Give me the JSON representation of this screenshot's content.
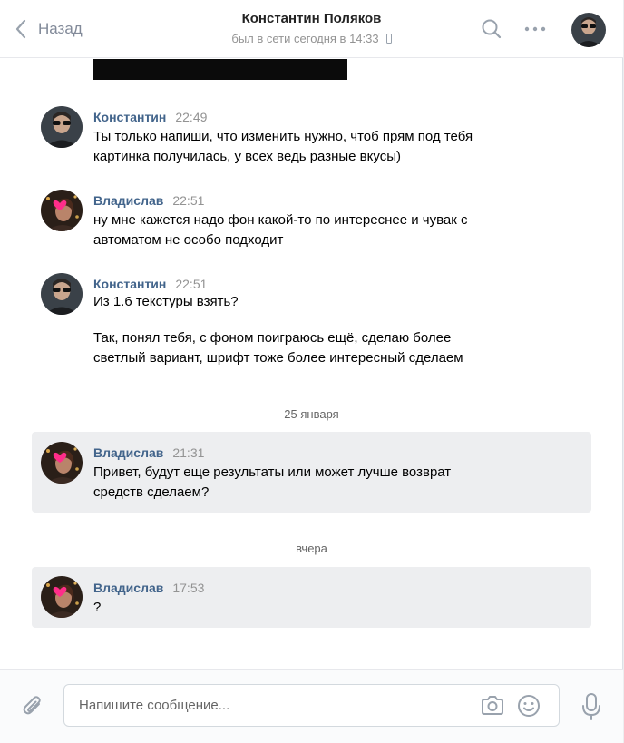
{
  "header": {
    "back_label": "Назад",
    "peer_name": "Константин Поляков",
    "peer_status": "был в сети сегодня в 14:33"
  },
  "icons": {
    "back": "chevron-left-icon",
    "search": "search-icon",
    "more": "more-horizontal-icon",
    "phone": "mobile-phone-icon",
    "attach": "paperclip-icon",
    "camera": "camera-icon",
    "smile": "smile-icon",
    "mic": "microphone-icon"
  },
  "colors": {
    "author": "#42648b",
    "unread_bg": "#edeef0",
    "muted": "#939393"
  },
  "messages": [
    {
      "author": "Константин",
      "time": "22:49",
      "lines": [
        "Ты только напиши, что изменить нужно, чтоб прям под тебя",
        "картинка получилась, у всех ведь разные вкусы)"
      ],
      "unread": false
    },
    {
      "author": "Владислав",
      "time": "22:51",
      "lines": [
        "ну мне кажется надо фон какой-то по интереснее и чувак с",
        "автоматом не особо подходит"
      ],
      "unread": false
    },
    {
      "author": "Константин",
      "time": "22:51",
      "lines": [
        "Из 1.6 текстуры взять?"
      ],
      "extra_lines": [
        "Так, понял тебя, с фоном поиграюсь ещё, сделаю более",
        "светлый вариант, шрифт тоже более интересный сделаем"
      ],
      "unread": false
    },
    {
      "author": "Владислав",
      "time": "21:31",
      "lines": [
        "Привет, будут еще результаты или может лучше возврат",
        "средств сделаем?"
      ],
      "unread": true
    },
    {
      "author": "Владислав",
      "time": "17:53",
      "lines": [
        "?"
      ],
      "unread": true
    }
  ],
  "dividers": [
    "25 января",
    "вчера"
  ],
  "composer": {
    "placeholder": "Напишите сообщение..."
  }
}
